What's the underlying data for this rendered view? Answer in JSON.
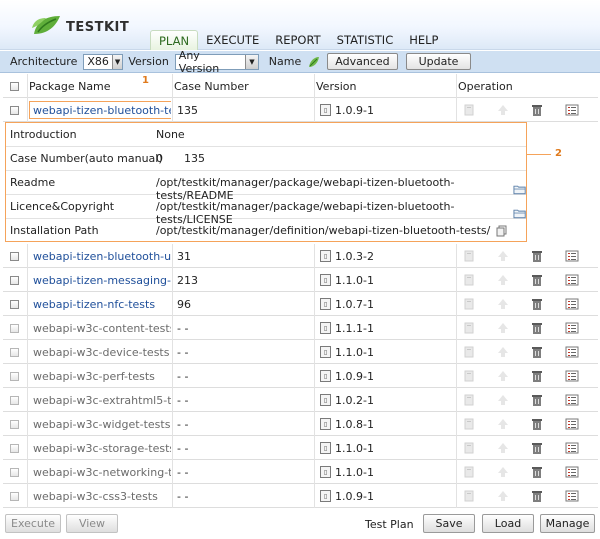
{
  "app": {
    "logo_text": "TESTKIT"
  },
  "nav": {
    "items": [
      "PLAN",
      "EXECUTE",
      "REPORT",
      "STATISTIC",
      "HELP"
    ],
    "active": "PLAN"
  },
  "toolbar": {
    "architecture_label": "Architecture",
    "architecture_value": "X86",
    "version_label": "Version",
    "version_value": "Any Version",
    "name_label": "Name",
    "advanced_label": "Advanced",
    "update_label": "Update"
  },
  "table": {
    "headers": {
      "name": "Package Name",
      "count": "Case Number",
      "version": "Version",
      "operation": "Operation"
    },
    "rows": [
      {
        "name": "webapi-tizen-bluetooth-te...",
        "count": "135",
        "version": "1.0.9-1",
        "active": true
      },
      {
        "name": "webapi-tizen-bluetooth-u...",
        "count": "31",
        "version": "1.0.3-2",
        "active": true
      },
      {
        "name": "webapi-tizen-messaging-...",
        "count": "213",
        "version": "1.1.0-1",
        "active": true
      },
      {
        "name": "webapi-tizen-nfc-tests",
        "count": "96",
        "version": "1.0.7-1",
        "active": true
      },
      {
        "name": "webapi-w3c-content-tests",
        "count": "- -",
        "version": "1.1.1-1",
        "active": false
      },
      {
        "name": "webapi-w3c-device-tests",
        "count": "- -",
        "version": "1.1.0-1",
        "active": false
      },
      {
        "name": "webapi-w3c-perf-tests",
        "count": "- -",
        "version": "1.0.9-1",
        "active": false
      },
      {
        "name": "webapi-w3c-extrahtml5-te...",
        "count": "- -",
        "version": "1.0.2-1",
        "active": false
      },
      {
        "name": "webapi-w3c-widget-tests",
        "count": "- -",
        "version": "1.0.8-1",
        "active": false
      },
      {
        "name": "webapi-w3c-storage-tests",
        "count": "- -",
        "version": "1.1.0-1",
        "active": false
      },
      {
        "name": "webapi-w3c-networking-te...",
        "count": "- -",
        "version": "1.1.0-1",
        "active": false
      },
      {
        "name": "webapi-w3c-css3-tests",
        "count": "- -",
        "version": "1.0.9-1",
        "active": false
      }
    ]
  },
  "details": {
    "rows": [
      {
        "label": "Introduction",
        "value": "None"
      },
      {
        "label": "Case Number(auto manual)",
        "value": "0      135"
      },
      {
        "label": "Readme",
        "value": "/opt/testkit/manager/package/webapi-tizen-bluetooth-tests/README",
        "icon": "folder-icon"
      },
      {
        "label": "Licence&Copyright",
        "value": "/opt/testkit/manager/package/webapi-tizen-bluetooth-tests/LICENSE",
        "icon": "folder-icon"
      },
      {
        "label": "Installation Path",
        "value": "/opt/testkit/manager/definition/webapi-tizen-bluetooth-tests/",
        "icon": "copy-icon"
      }
    ]
  },
  "annotations": {
    "one": "1",
    "two": "2"
  },
  "footer": {
    "execute_label": "Execute",
    "view_label": "View",
    "test_plan_label": "Test Plan",
    "save_label": "Save",
    "load_label": "Load",
    "manage_label": "Manage"
  },
  "colors": {
    "accent_link": "#1f4f9a",
    "highlight": "#f5a35a",
    "toolbar_bg": "#cfe0f2"
  }
}
